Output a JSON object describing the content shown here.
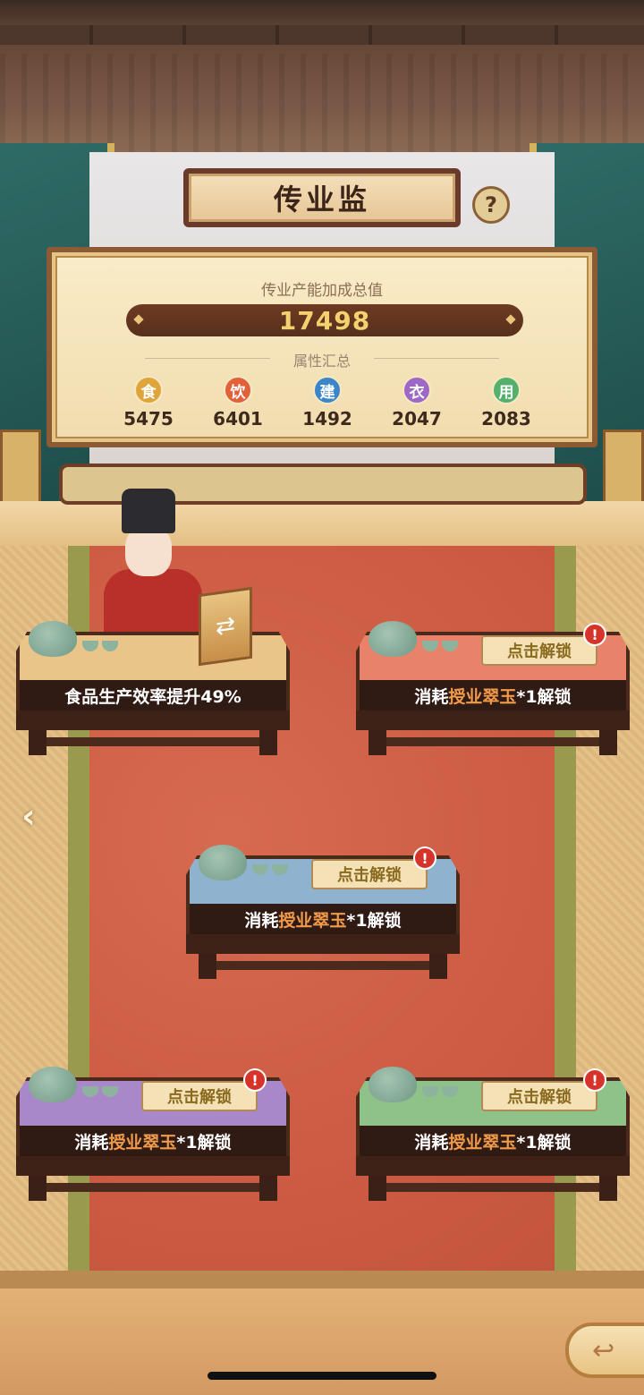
{
  "header": {
    "title": "传业监",
    "help_icon": "?"
  },
  "summary": {
    "label": "传业产能加成总值",
    "total": "17498",
    "attr_title": "属性汇总",
    "attributes": [
      {
        "icon": "食",
        "value": "5475",
        "color": "#e0a53a"
      },
      {
        "icon": "饮",
        "value": "6401",
        "color": "#e0613a"
      },
      {
        "icon": "建",
        "value": "1492",
        "color": "#3a86c9"
      },
      {
        "icon": "衣",
        "value": "2047",
        "color": "#9e68c6"
      },
      {
        "icon": "用",
        "value": "2083",
        "color": "#54b06a"
      }
    ]
  },
  "tables": [
    {
      "label": "食品生产效率提升49%",
      "color": "#e9c58a",
      "unlocked": true
    },
    {
      "label_pre": "消耗",
      "label_hl": "授业翠玉",
      "label_post": "*1解锁",
      "button": "点击解锁",
      "badge": "!",
      "color": "#e8826a"
    },
    {
      "label_pre": "消耗",
      "label_hl": "授业翠玉",
      "label_post": "*1解锁",
      "button": "点击解锁",
      "badge": "!",
      "color": "#8fb2cf"
    },
    {
      "label_pre": "消耗",
      "label_hl": "授业翠玉",
      "label_post": "*1解锁",
      "button": "点击解锁",
      "badge": "!",
      "color": "#a888c8"
    },
    {
      "label_pre": "消耗",
      "label_hl": "授业翠玉",
      "label_post": "*1解锁",
      "button": "点击解锁",
      "badge": "!",
      "color": "#8fc288"
    }
  ],
  "nav": {
    "back_icon": "chevron-left-icon",
    "return_icon": "return-arrow-icon"
  }
}
